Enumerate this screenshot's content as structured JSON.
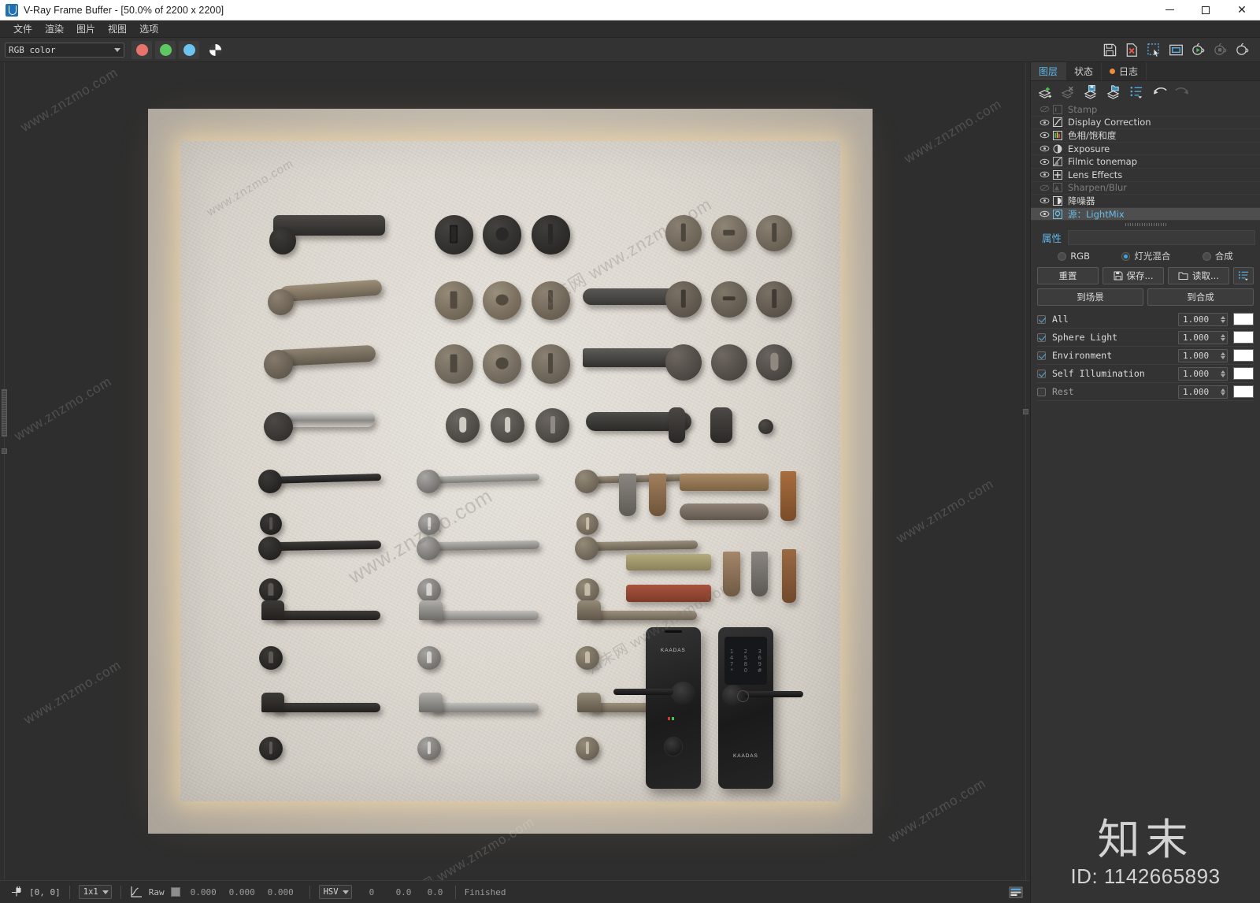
{
  "window": {
    "title": "V-Ray Frame Buffer - [50.0% of 2200 x 2200]",
    "logo_icon": "vray-logo-icon",
    "minimize_icon": "minimize-icon",
    "maximize_icon": "maximize-icon",
    "close_icon": "close-icon"
  },
  "menubar": {
    "items": [
      {
        "label": "文件"
      },
      {
        "label": "渲染"
      },
      {
        "label": "图片"
      },
      {
        "label": "视图"
      },
      {
        "label": "选项"
      }
    ]
  },
  "toolbar": {
    "channel_select": {
      "value": "RGB color",
      "caret_icon": "chevron-down-icon"
    },
    "channels": [
      {
        "name": "red-channel-button",
        "color": "#e8736d"
      },
      {
        "name": "green-channel-button",
        "color": "#5ec962"
      },
      {
        "name": "blue-channel-button",
        "color": "#6ec4f0"
      }
    ],
    "alpha_button": "alpha-channel-button",
    "right_icons": [
      {
        "name": "save-image-icon"
      },
      {
        "name": "clear-image-icon"
      },
      {
        "name": "region-select-icon"
      },
      {
        "name": "fit-view-icon"
      },
      {
        "name": "render-start-icon"
      },
      {
        "name": "render-stop-icon"
      },
      {
        "name": "render-last-icon"
      }
    ]
  },
  "render": {
    "watermarks": [
      {
        "text": "www.znzmo.com"
      },
      {
        "text": "知末网 www.znzmo.com"
      },
      {
        "text": "www.znzmo.com"
      },
      {
        "text": "知末网 www.znzmo.com"
      }
    ],
    "lock_brand": "KAADAS",
    "keypad_keys": [
      "1",
      "2",
      "3",
      "4",
      "5",
      "6",
      "7",
      "8",
      "9",
      "*",
      "0",
      "#"
    ]
  },
  "statusbar": {
    "lock_icon": "pixel-lock-icon",
    "coords": "[0,  0]",
    "sample_size": {
      "value": "1x1",
      "caret_icon": "chevron-down-icon"
    },
    "curve_icon": "color-curve-icon",
    "raw_label": "Raw",
    "swatch_name": "color-swatch",
    "rgb_values": [
      "0.000",
      "0.000",
      "0.000"
    ],
    "color_mode": {
      "value": "HSV",
      "caret_icon": "chevron-down-icon"
    },
    "hsv_values": [
      "0",
      "0.0",
      "0.0"
    ],
    "status": "Finished",
    "panel_toggle_icon": "toggle-panel-icon"
  },
  "right_panel": {
    "tabs": [
      {
        "label": "图层",
        "active": true,
        "dot": false
      },
      {
        "label": "状态",
        "active": false,
        "dot": false
      },
      {
        "label": "日志",
        "active": false,
        "dot": true
      }
    ],
    "layer_toolbar": [
      {
        "name": "add-layer-icon"
      },
      {
        "name": "delete-layer-icon"
      },
      {
        "name": "save-layers-icon"
      },
      {
        "name": "load-layers-icon"
      },
      {
        "name": "layer-presets-icon"
      },
      {
        "name": "undo-icon"
      },
      {
        "name": "redo-icon"
      }
    ],
    "layers": [
      {
        "label": "Stamp",
        "icon": "stamp-icon",
        "visible": false,
        "selected": false
      },
      {
        "label": "Display Correction",
        "icon": "curve-icon",
        "visible": true,
        "selected": false
      },
      {
        "label": "色相/饱和度",
        "icon": "hue-sat-icon",
        "visible": true,
        "selected": false
      },
      {
        "label": "Exposure",
        "icon": "exposure-icon",
        "visible": true,
        "selected": false
      },
      {
        "label": "Filmic tonemap",
        "icon": "tonemap-icon",
        "visible": true,
        "selected": false
      },
      {
        "label": "Lens Effects",
        "icon": "lens-effects-icon",
        "visible": true,
        "selected": false
      },
      {
        "label": "Sharpen/Blur",
        "icon": "sharpen-blur-icon",
        "visible": false,
        "selected": false
      },
      {
        "label": "降噪器",
        "icon": "denoiser-icon",
        "visible": true,
        "selected": false
      },
      {
        "label": "源：LightMix",
        "icon": "lightmix-icon",
        "visible": true,
        "selected": true
      }
    ],
    "properties": {
      "title": "属性",
      "modes": [
        {
          "label": "RGB",
          "selected": false
        },
        {
          "label": "灯光混合",
          "selected": true
        },
        {
          "label": "合成",
          "selected": false
        }
      ],
      "buttons": [
        {
          "label": "重置",
          "icon": null,
          "name": "reset-button"
        },
        {
          "label": "保存...",
          "icon": "save-icon",
          "name": "save-button"
        },
        {
          "label": "读取...",
          "icon": "open-icon",
          "name": "load-button"
        }
      ],
      "menu_button": {
        "name": "properties-menu-button",
        "icon": "list-menu-icon"
      },
      "secondary_buttons": [
        {
          "label": "到场景",
          "name": "to-scene-button"
        },
        {
          "label": "到合成",
          "name": "to-composite-button"
        }
      ],
      "lightmix": [
        {
          "label": "All",
          "enabled": true,
          "value": "1.000",
          "color": "#ffffff"
        },
        {
          "label": "Sphere Light",
          "enabled": true,
          "value": "1.000",
          "color": "#ffffff"
        },
        {
          "label": "Environment",
          "enabled": true,
          "value": "1.000",
          "color": "#ffffff"
        },
        {
          "label": "Self Illumination",
          "enabled": true,
          "value": "1.000",
          "color": "#ffffff"
        },
        {
          "label": "Rest",
          "enabled": false,
          "value": "1.000",
          "color": "#ffffff"
        }
      ]
    },
    "watermark": {
      "logo": "知末",
      "id": "ID: 1142665893"
    }
  }
}
